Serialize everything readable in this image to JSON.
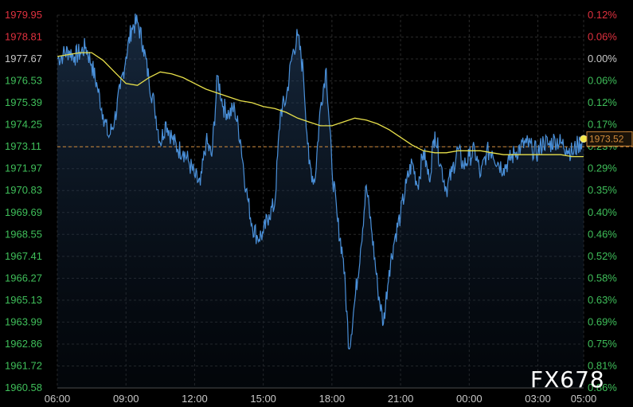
{
  "chart_data": {
    "type": "line",
    "grid": true,
    "legend": "none",
    "y_left_ticks": [
      "1979.95",
      "1978.81",
      "1977.67",
      "1976.53",
      "1975.39",
      "1974.25",
      "1973.11",
      "1971.97",
      "1970.83",
      "1969.69",
      "1968.55",
      "1967.41",
      "1966.27",
      "1965.13",
      "1963.99",
      "1962.86",
      "1961.72",
      "1960.58"
    ],
    "y_right_ticks": [
      "0.12%",
      "0.06%",
      "0.00%",
      "0.06%",
      "0.12%",
      "0.17%",
      "0.23%",
      "0.29%",
      "0.35%",
      "0.40%",
      "0.46%",
      "0.52%",
      "0.58%",
      "0.63%",
      "0.69%",
      "0.75%",
      "0.81%",
      "0.86%"
    ],
    "x_ticks": [
      "06:00",
      "09:00",
      "12:00",
      "15:00",
      "18:00",
      "21:00",
      "00:00",
      "03:00",
      "05:00"
    ],
    "x_tick_hours": [
      0,
      3,
      6,
      9,
      12,
      15,
      18,
      21,
      23
    ],
    "ylim": [
      1960.58,
      1979.95
    ],
    "xlim_hours": [
      0,
      23
    ],
    "reference_price": 1973.11,
    "last_price": "1973.52",
    "last_value": 1973.52,
    "series": [
      {
        "color": "#4a90d9",
        "x_hours": [
          0,
          0.25,
          0.5,
          0.75,
          1.0,
          1.25,
          1.5,
          1.75,
          2.0,
          2.25,
          2.5,
          2.75,
          3.0,
          3.25,
          3.5,
          3.75,
          4.0,
          4.25,
          4.5,
          4.75,
          5.0,
          5.25,
          5.5,
          5.75,
          6.0,
          6.25,
          6.5,
          6.75,
          7.0,
          7.25,
          7.5,
          7.75,
          8.0,
          8.25,
          8.5,
          8.75,
          9.0,
          9.25,
          9.5,
          9.75,
          10.0,
          10.25,
          10.5,
          10.75,
          11.0,
          11.25,
          11.5,
          11.75,
          12.0,
          12.25,
          12.5,
          12.75,
          13.0,
          13.25,
          13.5,
          13.75,
          14.0,
          14.25,
          14.5,
          14.75,
          15.0,
          15.25,
          15.5,
          15.75,
          16.0,
          16.25,
          16.5,
          16.75,
          17.0,
          17.25,
          17.5,
          17.75,
          18.0,
          18.25,
          18.5,
          18.75,
          19.0,
          19.25,
          19.5,
          19.75,
          20.0,
          20.25,
          20.5,
          20.75,
          21.0,
          21.25,
          21.5,
          21.75,
          22.0,
          22.25,
          22.5,
          22.75,
          23.0
        ],
        "values": [
          1977.7,
          1977.9,
          1978.1,
          1977.8,
          1978.0,
          1978.3,
          1977.4,
          1976.2,
          1974.8,
          1973.6,
          1974.5,
          1976.1,
          1977.8,
          1979.3,
          1979.6,
          1978.4,
          1976.6,
          1975.2,
          1973.3,
          1974.4,
          1973.6,
          1973.0,
          1972.9,
          1972.3,
          1971.6,
          1971.1,
          1973.4,
          1972.6,
          1976.8,
          1975.2,
          1974.8,
          1975.1,
          1973.5,
          1970.9,
          1969.1,
          1968.4,
          1968.6,
          1969.6,
          1970.1,
          1974.9,
          1975.6,
          1977.8,
          1978.9,
          1977.0,
          1972.2,
          1971.3,
          1975.2,
          1977.2,
          1972.0,
          1969.2,
          1967.3,
          1962.6,
          1965.1,
          1967.8,
          1971.1,
          1968.6,
          1965.8,
          1963.9,
          1966.7,
          1968.4,
          1969.6,
          1971.2,
          1972.3,
          1971.1,
          1972.9,
          1971.4,
          1973.9,
          1972.2,
          1970.9,
          1971.8,
          1973.0,
          1972.1,
          1972.6,
          1972.9,
          1971.6,
          1972.8,
          1972.9,
          1972.3,
          1972.0,
          1972.4,
          1972.8,
          1973.1,
          1973.3,
          1973.0,
          1972.8,
          1973.4,
          1973.2,
          1973.5,
          1973.3,
          1973.1,
          1972.8,
          1973.2,
          1973.52
        ]
      },
      {
        "color": "#e8e04a",
        "x_hours": [
          0,
          0.5,
          1.0,
          1.5,
          2.0,
          2.5,
          3.0,
          3.5,
          4.0,
          4.5,
          5.0,
          5.5,
          6.0,
          6.5,
          7.0,
          7.5,
          8.0,
          8.5,
          9.0,
          9.5,
          10.0,
          10.5,
          11.0,
          11.5,
          12.0,
          12.5,
          13.0,
          13.5,
          14.0,
          14.5,
          15.0,
          15.5,
          16.0,
          16.5,
          17.0,
          17.5,
          18.0,
          18.5,
          19.0,
          19.5,
          20.0,
          20.5,
          21.0,
          21.5,
          22.0,
          22.5,
          23.0
        ],
        "values": [
          1977.8,
          1977.9,
          1978.0,
          1978.0,
          1977.6,
          1977.0,
          1976.4,
          1976.3,
          1976.7,
          1977.0,
          1976.9,
          1976.7,
          1976.4,
          1976.1,
          1975.9,
          1975.7,
          1975.5,
          1975.4,
          1975.2,
          1975.1,
          1974.9,
          1974.6,
          1974.4,
          1974.2,
          1974.2,
          1974.4,
          1974.6,
          1974.5,
          1974.3,
          1974.0,
          1973.6,
          1973.2,
          1972.9,
          1972.8,
          1972.8,
          1972.9,
          1972.9,
          1972.9,
          1972.8,
          1972.7,
          1972.7,
          1972.7,
          1972.7,
          1972.7,
          1972.7,
          1972.6,
          1972.6
        ]
      }
    ]
  },
  "watermark": "FX678"
}
